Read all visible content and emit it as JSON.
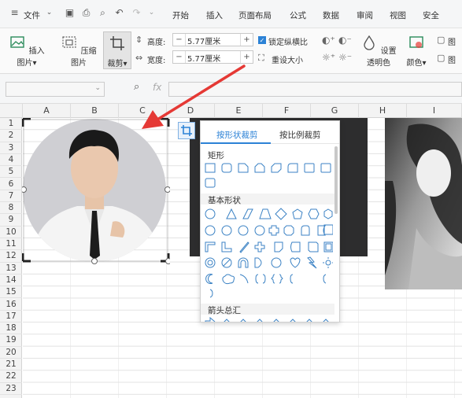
{
  "menubar": {
    "file_label": "文件",
    "tabs": [
      "开始",
      "插入",
      "页面布局",
      "公式",
      "数据",
      "审阅",
      "视图",
      "安全"
    ]
  },
  "ribbon": {
    "insert_picture": "插入图片",
    "compress_picture": "压缩图片",
    "crop": "裁剪",
    "height_label": "高度:",
    "height_value": "5.77厘米",
    "width_label": "宽度:",
    "width_value": "5.77厘米",
    "lock_ratio": "锁定纵横比",
    "reset_size": "重设大小",
    "set_transparent": "设置透明色",
    "color": "颜色",
    "picture_trunc_1": "图",
    "picture_trunc_2": "图"
  },
  "formula_bar": {
    "fx": "fx"
  },
  "columns": [
    "A",
    "B",
    "C",
    "D",
    "E",
    "F",
    "G",
    "H",
    "I"
  ],
  "rows": [
    "1",
    "2",
    "3",
    "4",
    "5",
    "6",
    "7",
    "8",
    "9",
    "10",
    "11",
    "12",
    "13",
    "14",
    "15",
    "16",
    "17",
    "18",
    "19",
    "20",
    "21",
    "22",
    "23"
  ],
  "crop_popup": {
    "tab_shape": "按形状裁剪",
    "tab_ratio": "按比例裁剪",
    "section_rect": "矩形",
    "section_basic": "基本形状",
    "section_arrow": "箭头总汇"
  },
  "colors": {
    "accent": "#2c82d6",
    "arrow": "#e53935",
    "ribbon_bg": "#fafafa"
  }
}
